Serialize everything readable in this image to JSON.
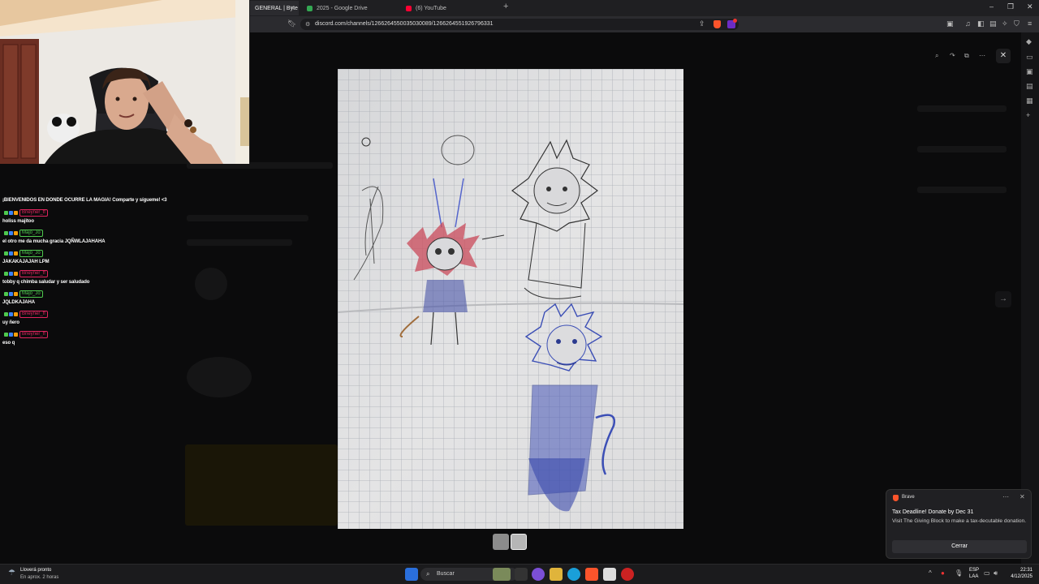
{
  "browser": {
    "tabs": [
      {
        "title": "GENERAL | Byte",
        "favicon_color": "#5865f2",
        "active": true
      },
      {
        "title": "2025 - Google Drive",
        "favicon_color": "#34a853",
        "active": false
      },
      {
        "title": "(6) YouTube",
        "favicon_color": "#ff0033",
        "active": false
      }
    ],
    "new_tab_label": "+",
    "url": "discord.com/channels/1266264550035030089/1266264551926796331"
  },
  "chat": {
    "messages": [
      {
        "user": "",
        "text": "¡BIENVENIDOS EN DONDE OCURRE LA MAGIA! Comparte y sígueme! <3"
      },
      {
        "user": "Bneyner_ff",
        "user_color": "#e0245e",
        "text": "holiss majitoo"
      },
      {
        "user": "Majo_Jo",
        "user_color": "#4ec94e",
        "text": "el otro me da mucha gracia JQÑWLAJAHAHA"
      },
      {
        "user": "Majo_Jo",
        "user_color": "#4ec94e",
        "text": "JAKAKAJAJAH LPM"
      },
      {
        "user": "Bneyner_ff",
        "user_color": "#e0245e",
        "text": "tobby q chimba saludar y ser saludado"
      },
      {
        "user": "Majo_Jo",
        "user_color": "#4ec94e",
        "text": "JQLDKAJAHA"
      },
      {
        "user": "Bneyner_ff",
        "user_color": "#e0245e",
        "text": "uy ñero"
      },
      {
        "user": "Bneyner_ff",
        "user_color": "#e0245e",
        "text": "eso q"
      }
    ]
  },
  "viewer": {
    "close_icon": "close-icon",
    "next_icon": "arrow-right-icon"
  },
  "notification": {
    "app": "Brave",
    "title": "Tax Deadline! Donate by Dec 31",
    "body": "Visit The Giving Block to make a tax-decutable donation.",
    "button": "Cerrar"
  },
  "taskbar": {
    "weather_line1": "Lloverá pronto",
    "weather_line2": "En aprox. 2 horas",
    "search_placeholder": "Buscar",
    "lang_line1": "ESP",
    "lang_line2": "LAA",
    "time": "22:31",
    "date": "4/12/2025"
  }
}
